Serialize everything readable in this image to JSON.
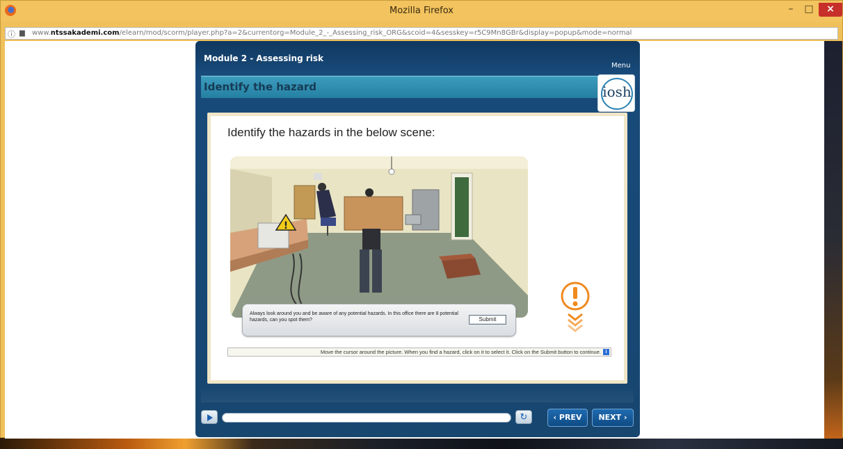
{
  "browser": {
    "window_title": "Mozilla Firefox",
    "url_prefix": "www.",
    "url_host": "ntssakademi.com",
    "url_path": "/elearn/mod/scorm/player.php?a=2&currentorg=Module_2_-_Assessing_risk_ORG&scoid=4&sesskey=r5C9Mn8GBr&display=popup&mode=normal",
    "controls": {
      "minimize": "–",
      "maximize": "□",
      "close": "×"
    },
    "icons": {
      "browser": "firefox-icon",
      "info": "info-icon",
      "page": "page-icon"
    }
  },
  "course": {
    "module_title": "Module 2 - Assessing risk",
    "menu_label": "Menu",
    "section_title": "Identify the hazard",
    "logo_text": "iosh",
    "question": "Identify the hazards in the below scene:",
    "callout_text": "Always look around you and be aware of any potential hazards. In this office there are 8 potential hazards, can you spot them?",
    "submit_label": "Submit",
    "instruction": "Move the cursor around the picture. When you find a hazard, click on it to select it. Click on the Submit button to continue.",
    "info_glyph": "i"
  },
  "controls": {
    "prev_label": "‹ PREV",
    "next_label": "NEXT ›",
    "replay_glyph": "↻",
    "progress": 0
  },
  "colors": {
    "titlebar": "#f2c35e",
    "player_bg": "#17466f",
    "section_bar": "#2e8cb0",
    "nav_button": "#1a5fa0",
    "alert_orange": "#f08a1e"
  }
}
